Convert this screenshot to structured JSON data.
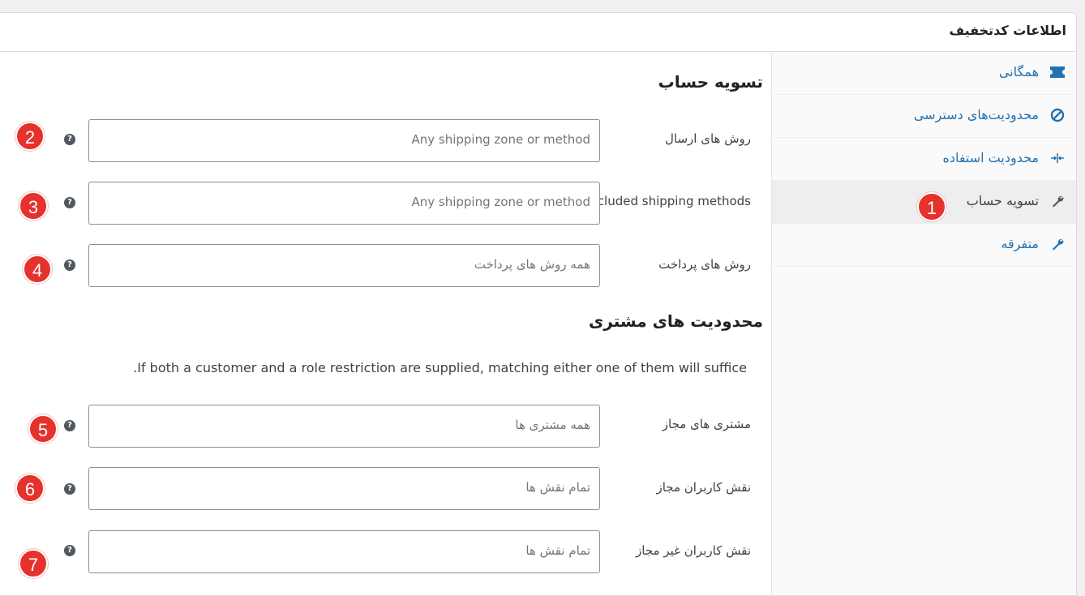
{
  "panel": {
    "title": "اطلاعات کدتخفیف"
  },
  "tabs": [
    {
      "label": "همگانی",
      "icon": "ticket-icon"
    },
    {
      "label": "محدودیت‌های دسترسی",
      "icon": "block-icon"
    },
    {
      "label": "محدودیت استفاده",
      "icon": "arrows-in-icon"
    },
    {
      "label": "تسویه حساب",
      "icon": "wrench-icon",
      "active": true
    },
    {
      "label": "متفرقه",
      "icon": "wrench-icon"
    }
  ],
  "checkout_section": {
    "heading": "تسویه حساب",
    "fields": [
      {
        "label": "روش های ارسال",
        "placeholder": "Any shipping zone or method"
      },
      {
        "label": "Excluded shipping methods",
        "placeholder": "Any shipping zone or method"
      },
      {
        "label": "روش های پرداخت",
        "placeholder": "همه روش های پرداخت"
      }
    ]
  },
  "customer_section": {
    "heading": "محدودیت های مشتری",
    "notice": ".If both a customer and a role restriction are supplied, matching either one of them will suffice",
    "fields": [
      {
        "label": "مشتری های مجاز",
        "placeholder": "همه مشتری ها"
      },
      {
        "label": "نقش کاربران مجاز",
        "placeholder": "تمام نقش ها"
      },
      {
        "label": "نقش کاربران غیر مجاز",
        "placeholder": "تمام نقش ها"
      }
    ]
  },
  "help_symbol": "?",
  "badges": [
    "1",
    "2",
    "3",
    "4",
    "5",
    "6",
    "7"
  ],
  "colors": {
    "accent": "#2271b1",
    "badge": "#e5322d",
    "active_tab_bg": "#eeeeee"
  }
}
